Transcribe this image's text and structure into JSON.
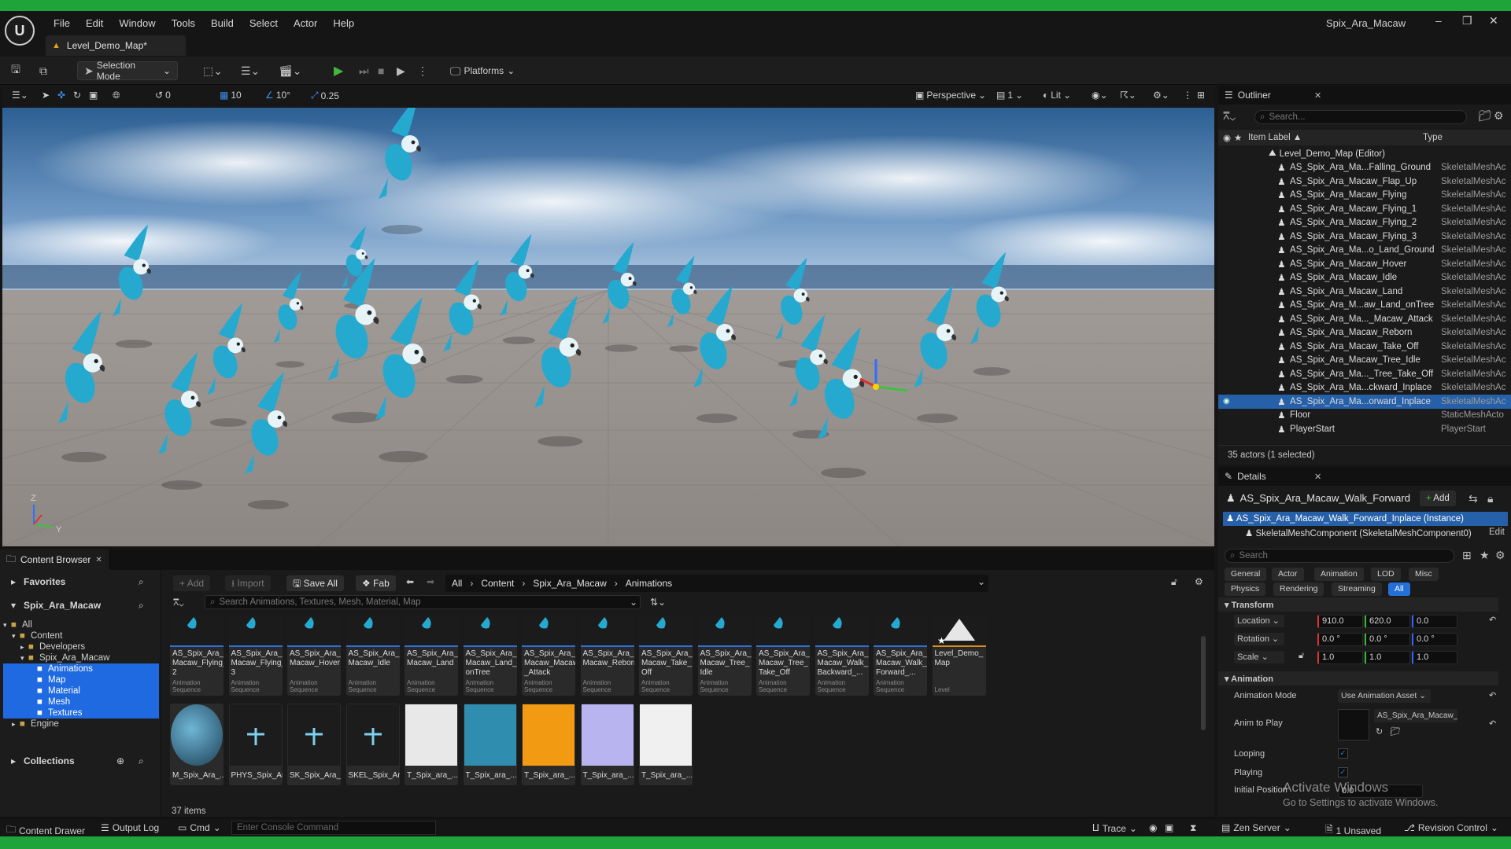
{
  "window": {
    "title": "Spix_Ara_Macaw",
    "document_tab": "Level_Demo_Map*",
    "menu": [
      "File",
      "Edit",
      "Window",
      "Tools",
      "Build",
      "Select",
      "Actor",
      "Help"
    ]
  },
  "toolbar": {
    "mode": "Selection Mode",
    "platforms": "Platforms"
  },
  "viewport": {
    "snap_rot": "0",
    "grid": "10",
    "angle": "10°",
    "scale": "0.25",
    "view": "Perspective",
    "cam_speed": "1",
    "lit": "Lit",
    "axis_z": "Z",
    "axis_y": "Y"
  },
  "outliner": {
    "tab": "Outliner",
    "search_placeholder": "Search...",
    "col_label": "Item Label ▲",
    "col_type": "Type",
    "root": "Level_Demo_Map (Editor)",
    "items": [
      {
        "name": "AS_Spix_Ara_Ma...Falling_Ground",
        "type": "SkeletalMeshAc"
      },
      {
        "name": "AS_Spix_Ara_Macaw_Flap_Up",
        "type": "SkeletalMeshAc"
      },
      {
        "name": "AS_Spix_Ara_Macaw_Flying",
        "type": "SkeletalMeshAc"
      },
      {
        "name": "AS_Spix_Ara_Macaw_Flying_1",
        "type": "SkeletalMeshAc"
      },
      {
        "name": "AS_Spix_Ara_Macaw_Flying_2",
        "type": "SkeletalMeshAc"
      },
      {
        "name": "AS_Spix_Ara_Macaw_Flying_3",
        "type": "SkeletalMeshAc"
      },
      {
        "name": "AS_Spix_Ara_Ma...o_Land_Ground",
        "type": "SkeletalMeshAc"
      },
      {
        "name": "AS_Spix_Ara_Macaw_Hover",
        "type": "SkeletalMeshAc"
      },
      {
        "name": "AS_Spix_Ara_Macaw_Idle",
        "type": "SkeletalMeshAc"
      },
      {
        "name": "AS_Spix_Ara_Macaw_Land",
        "type": "SkeletalMeshAc"
      },
      {
        "name": "AS_Spix_Ara_M...aw_Land_onTree",
        "type": "SkeletalMeshAc"
      },
      {
        "name": "AS_Spix_Ara_Ma..._Macaw_Attack",
        "type": "SkeletalMeshAc"
      },
      {
        "name": "AS_Spix_Ara_Macaw_Reborn",
        "type": "SkeletalMeshAc"
      },
      {
        "name": "AS_Spix_Ara_Macaw_Take_Off",
        "type": "SkeletalMeshAc"
      },
      {
        "name": "AS_Spix_Ara_Macaw_Tree_Idle",
        "type": "SkeletalMeshAc"
      },
      {
        "name": "AS_Spix_Ara_Ma..._Tree_Take_Off",
        "type": "SkeletalMeshAc"
      },
      {
        "name": "AS_Spix_Ara_Ma...ckward_Inplace",
        "type": "SkeletalMeshAc"
      },
      {
        "name": "AS_Spix_Ara_Ma...orward_Inplace",
        "type": "SkeletalMeshAc",
        "selected": true
      },
      {
        "name": "Floor",
        "type": "StaticMeshActo"
      },
      {
        "name": "PlayerStart",
        "type": "PlayerStart"
      }
    ],
    "footer": "35 actors (1 selected)"
  },
  "details": {
    "tab": "Details",
    "actor_name": "AS_Spix_Ara_Macaw_Walk_Forward",
    "add_label": "Add",
    "instance": "AS_Spix_Ara_Macaw_Walk_Forward_Inplace (Instance)",
    "component": "SkeletalMeshComponent (SkeletalMeshComponent0)",
    "edit_label": "Edit",
    "search_placeholder": "Search",
    "filters_row1": [
      "General",
      "Actor",
      "Animation",
      "LOD",
      "Misc"
    ],
    "filters_row2": [
      "Physics",
      "Rendering",
      "Streaming",
      "All"
    ],
    "transform_header": "Transform",
    "location_label": "Location",
    "location": [
      "910.0",
      "620.0",
      "0.0"
    ],
    "rotation_label": "Rotation",
    "rotation": [
      "0.0 °",
      "0.0 °",
      "0.0 °"
    ],
    "scale_label": "Scale",
    "scale": [
      "1.0",
      "1.0",
      "1.0"
    ],
    "animation_header": "Animation",
    "anim_mode_label": "Animation Mode",
    "anim_mode": "Use Animation Asset",
    "anim_to_play_label": "Anim to Play",
    "anim_to_play": "AS_Spix_Ara_Macaw_W",
    "looping_label": "Looping",
    "playing_label": "Playing",
    "initial_pos_label": "Initial Position",
    "initial_pos": "0.0",
    "activate_title": "Activate Windows",
    "activate_sub": "Go to Settings to activate Windows."
  },
  "content_browser": {
    "tab": "Content Browser",
    "favorites": "Favorites",
    "project": "Spix_Ara_Macaw",
    "collections": "Collections",
    "btn_add": "Add",
    "btn_import": "Import",
    "btn_save_all": "Save All",
    "btn_fab": "Fab",
    "path": [
      "All",
      "Content",
      "Spix_Ara_Macaw",
      "Animations"
    ],
    "search_placeholder": "Search Animations, Textures, Mesh, Material, Map",
    "tree": [
      {
        "label": "All",
        "indent": 0
      },
      {
        "label": "Content",
        "indent": 1
      },
      {
        "label": "Developers",
        "indent": 2
      },
      {
        "label": "Spix_Ara_Macaw",
        "indent": 2
      },
      {
        "label": "Animations",
        "indent": 3,
        "selected": true
      },
      {
        "label": "Map",
        "indent": 3,
        "selected": true
      },
      {
        "label": "Material",
        "indent": 3,
        "selected": true
      },
      {
        "label": "Mesh",
        "indent": 3,
        "selected": true
      },
      {
        "label": "Textures",
        "indent": 3,
        "selected": true
      },
      {
        "label": "Engine",
        "indent": 1
      }
    ],
    "anim_assets": [
      {
        "label": "AS_Spix_Ara_ Macaw_Flying_ 2",
        "kind": "Animation Sequence"
      },
      {
        "label": "AS_Spix_Ara_ Macaw_Flying_ 3",
        "kind": "Animation Sequence"
      },
      {
        "label": "AS_Spix_Ara_ Macaw_Hover",
        "kind": "Animation Sequence"
      },
      {
        "label": "AS_Spix_Ara_ Macaw_Idle",
        "kind": "Animation Sequence"
      },
      {
        "label": "AS_Spix_Ara_ Macaw_Land",
        "kind": "Animation Sequence"
      },
      {
        "label": "AS_Spix_Ara_ Macaw_Land_ onTree",
        "kind": "Animation Sequence"
      },
      {
        "label": "AS_Spix_Ara_ Macaw_Macaw _Attack",
        "kind": "Animation Sequence"
      },
      {
        "label": "AS_Spix_Ara_ Macaw_Reborn",
        "kind": "Animation Sequence"
      },
      {
        "label": "AS_Spix_Ara_ Macaw_Take_ Off",
        "kind": "Animation Sequence"
      },
      {
        "label": "AS_Spix_Ara_ Macaw_Tree_ Idle",
        "kind": "Animation Sequence"
      },
      {
        "label": "AS_Spix_Ara_ Macaw_Tree_ Take_Off",
        "kind": "Animation Sequence"
      },
      {
        "label": "AS_Spix_Ara_ Macaw_Walk_ Backward_...",
        "kind": "Animation Sequence"
      },
      {
        "label": "AS_Spix_Ara_ Macaw_Walk_ Forward_...",
        "kind": "Animation Sequence"
      },
      {
        "label": "Level_Demo_ Map",
        "kind": "Level"
      }
    ],
    "other_assets": [
      {
        "label": "M_Spix_Ara_...",
        "color": "#2f6a86"
      },
      {
        "label": "PHYS_Spix_Ara...",
        "color": "#1c1c1c"
      },
      {
        "label": "SK_Spix_Ara_...",
        "color": "#1c1c1c"
      },
      {
        "label": "SKEL_Spix_Ara...",
        "color": "#1c1c1c"
      },
      {
        "label": "T_Spix_ara_...",
        "color": "#e8e8e8"
      },
      {
        "label": "T_Spix_ara_...",
        "color": "#2f8db0"
      },
      {
        "label": "T_Spix_ara_...",
        "color": "#f29a12"
      },
      {
        "label": "T_Spix_ara_...",
        "color": "#b8b4f0"
      },
      {
        "label": "T_Spix_ara_...",
        "color": "#f0f0f0"
      }
    ],
    "item_count": "37 items"
  },
  "statusbar": {
    "content_drawer": "Content Drawer",
    "output_log": "Output Log",
    "cmd": "Cmd",
    "console_placeholder": "Enter Console Command",
    "trace": "Trace",
    "zen": "Zen Server",
    "unsaved": "1 Unsaved",
    "revision": "Revision Control"
  },
  "colors": {
    "accent": "#2470d6",
    "selection": "#2660a8",
    "play": "#42b83c",
    "macaw": "#25a9cf"
  }
}
